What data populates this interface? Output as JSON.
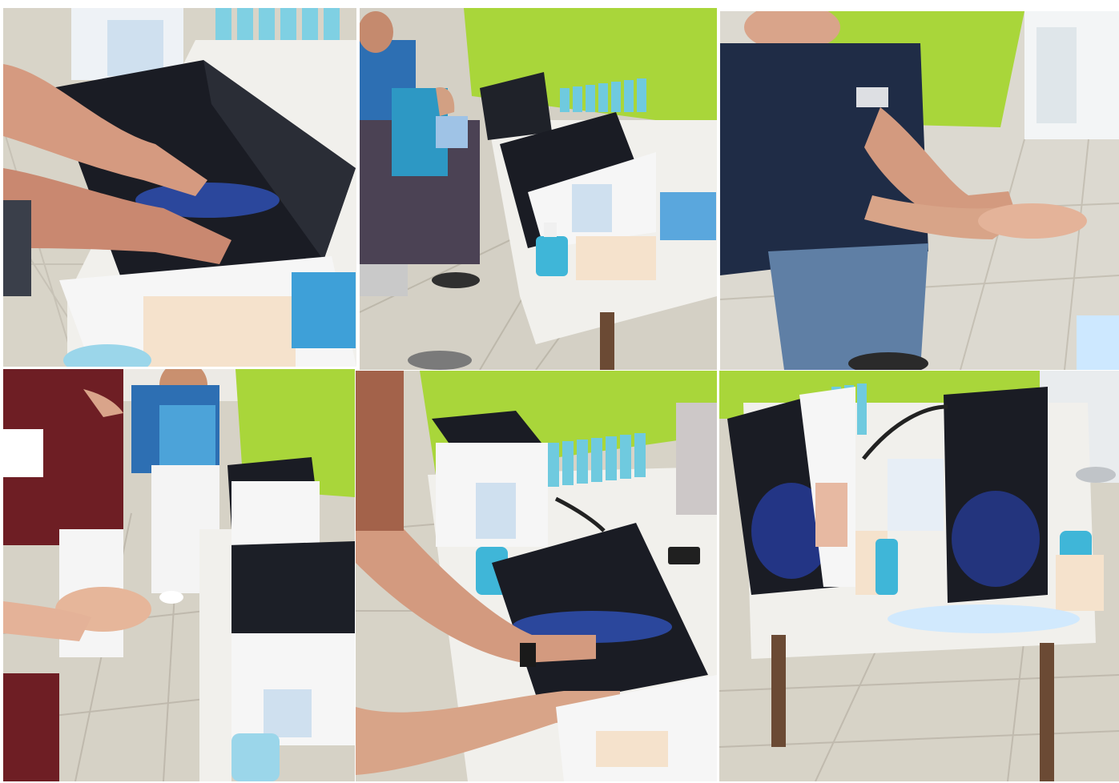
{
  "collage": {
    "photos": [
      {
        "id": "p1",
        "subject": "hands-under-uv-box"
      },
      {
        "id": "p2",
        "subject": "nurses-with-uv-box-table"
      },
      {
        "id": "p3",
        "subject": "person-rubbing-hands"
      },
      {
        "id": "p4",
        "subject": "staff-demonstrating-handrub"
      },
      {
        "id": "p5",
        "subject": "hands-in-uv-box-with-sanitizer"
      },
      {
        "id": "p6",
        "subject": "two-uv-boxes-on-table"
      }
    ],
    "colors": {
      "floor": "#d8d4c8",
      "wall_green": "#a9d63a",
      "uv_box_black": "#1a1c24",
      "uv_glow": "#3a6cff",
      "table_white": "#f1f0ec",
      "sanitizer_blue": "#3fb6d8",
      "shirt_navy": "#1f2c46",
      "scrub_maroon": "#6e1e24",
      "uniform_blue": "#2d6fb3"
    }
  }
}
